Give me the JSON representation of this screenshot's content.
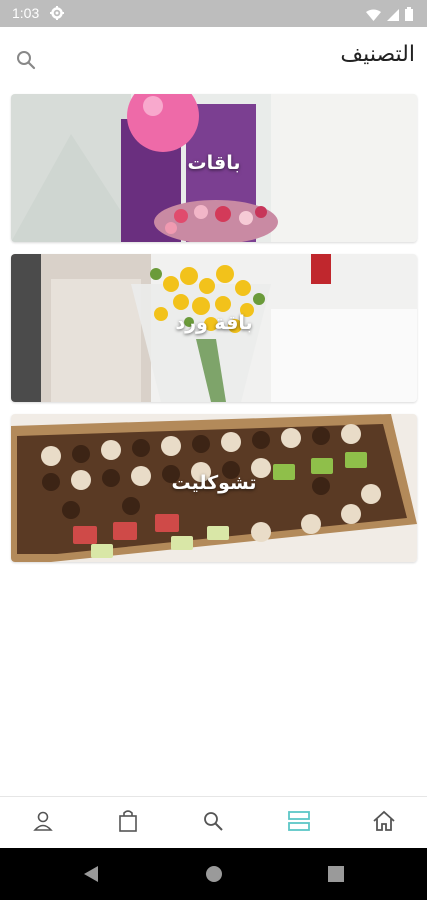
{
  "status_bar": {
    "time": "1:03"
  },
  "header": {
    "title": "التصنيف"
  },
  "categories": [
    {
      "label": "باقات"
    },
    {
      "label": "باقة ورد"
    },
    {
      "label": "تشوكليت"
    }
  ],
  "bottom_nav": {
    "items": [
      "profile-icon",
      "shopping-bag-icon",
      "search-icon",
      "categories-icon",
      "home-icon"
    ],
    "active_index": 3,
    "active_color": "#5cc6c6",
    "inactive_color": "#555555"
  }
}
